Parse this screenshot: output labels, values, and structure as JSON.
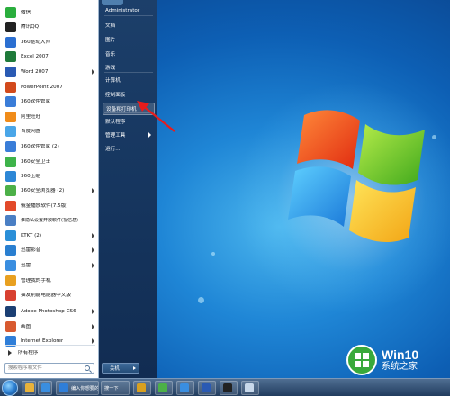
{
  "left_pane": {
    "apps": [
      {
        "label": "微信",
        "icon": "wechat-icon",
        "color": "#2aae3d",
        "submenu": false
      },
      {
        "label": "腾讯QQ",
        "icon": "qq-penguin-icon",
        "color": "#222222",
        "submenu": false
      },
      {
        "label": "360驱动大师",
        "icon": "driver-master-icon",
        "color": "#2b6fd1",
        "submenu": false
      },
      {
        "label": "Excel 2007",
        "icon": "excel-icon",
        "color": "#1f7a3a",
        "submenu": false
      },
      {
        "label": "Word 2007",
        "icon": "word-icon",
        "color": "#2a5ab3",
        "submenu": true
      },
      {
        "label": "PowerPoint 2007",
        "icon": "powerpoint-icon",
        "color": "#d24a1c",
        "submenu": false
      },
      {
        "label": "360软件管家",
        "icon": "software-manager-icon",
        "color": "#3a7dd8",
        "submenu": false
      },
      {
        "label": "阿里旺旺",
        "icon": "aliwangwang-icon",
        "color": "#f08c1a",
        "submenu": false
      },
      {
        "label": "百度网盘",
        "icon": "baidu-netdisk-icon",
        "color": "#4aa6e8",
        "submenu": false
      },
      {
        "label": "360软件管家 (2)",
        "icon": "software-manager-icon",
        "color": "#3a7dd8",
        "submenu": false
      },
      {
        "label": "360安全卫士",
        "icon": "security-guard-icon",
        "color": "#3eb34a",
        "submenu": false
      },
      {
        "label": "360压缩",
        "icon": "zip-icon",
        "color": "#2d87d6",
        "submenu": false
      },
      {
        "label": "360安全浏览器 (2)",
        "icon": "secure-browser-icon",
        "color": "#4cb048",
        "submenu": true
      },
      {
        "label": "俄金播放软件(7.5版)",
        "icon": "player-icon",
        "color": "#e24a2a",
        "submenu": false
      },
      {
        "label": "谁隐私设置开放软件(视信息)",
        "icon": "privacy-icon",
        "color": "#4a7fc4",
        "submenu": false
      },
      {
        "label": "KTKT (2)",
        "icon": "ktkt-icon",
        "color": "#2a8fd8",
        "submenu": true
      },
      {
        "label": "迅雷影音",
        "icon": "thunder-player-icon",
        "color": "#2a7fd0",
        "submenu": true
      },
      {
        "label": "迅雷",
        "icon": "thunder-icon",
        "color": "#3a8ee0",
        "submenu": true
      },
      {
        "label": "管理我的手机",
        "icon": "phone-manager-icon",
        "color": "#e8a020",
        "submenu": false
      },
      {
        "label": "猫友别能电能器中文版",
        "icon": "cat-app-icon",
        "color": "#d84030",
        "submenu": false
      },
      {
        "label": "Adobe Photoshop CS6",
        "icon": "photoshop-icon",
        "color": "#1b3f73",
        "submenu": true
      },
      {
        "label": "画图",
        "icon": "paint-icon",
        "color": "#d85a30",
        "submenu": true
      },
      {
        "label": "Internet Explorer",
        "icon": "internet-explorer-icon",
        "color": "#2f7ed8",
        "submenu": true
      },
      {
        "label": "",
        "icon": "blank-icon",
        "color": "#e6edf5",
        "submenu": true
      }
    ],
    "all_programs": "所有程序",
    "search_placeholder": "搜索程序和文件"
  },
  "right_pane": {
    "items": [
      {
        "label": "Administrator",
        "submenu": false,
        "highlighted": false
      },
      {
        "label": "文档",
        "submenu": false,
        "highlighted": false
      },
      {
        "label": "图片",
        "submenu": false,
        "highlighted": false
      },
      {
        "label": "音乐",
        "submenu": false,
        "highlighted": false
      },
      {
        "label": "游戏",
        "submenu": false,
        "highlighted": false
      },
      {
        "label": "计算机",
        "submenu": false,
        "highlighted": false
      },
      {
        "label": "控制面板",
        "submenu": false,
        "highlighted": false
      },
      {
        "label": "设备和打印机",
        "submenu": false,
        "highlighted": true
      },
      {
        "label": "默认程序",
        "submenu": false,
        "highlighted": false
      },
      {
        "label": "管理工具",
        "submenu": true,
        "highlighted": false
      },
      {
        "label": "运行...",
        "submenu": false,
        "highlighted": false
      }
    ],
    "shutdown_label": "关机"
  },
  "taskbar": {
    "items": [
      {
        "label": "",
        "icon": "folder-icon",
        "color": "#e8b23a"
      },
      {
        "label": "",
        "icon": "player-icon",
        "color": "#3a8ee0"
      },
      {
        "label": "编入你想要的",
        "icon": "internet-explorer-icon",
        "color": "#2f7ed8"
      },
      {
        "label": "搜一下",
        "icon": "",
        "color": ""
      },
      {
        "label": "",
        "icon": "chess-icon",
        "color": "#d8a020"
      },
      {
        "label": "",
        "icon": "browser-icon",
        "color": "#4cb048"
      },
      {
        "label": "",
        "icon": "network-icon",
        "color": "#3a8ee0"
      },
      {
        "label": "",
        "icon": "word-icon",
        "color": "#2a5ab3"
      },
      {
        "label": "",
        "icon": "terminal-icon",
        "color": "#222222"
      },
      {
        "label": "",
        "icon": "notepad-icon",
        "color": "#c8d8ea"
      }
    ]
  },
  "watermark": {
    "title": "Win10",
    "subtitle": "系统之家"
  }
}
